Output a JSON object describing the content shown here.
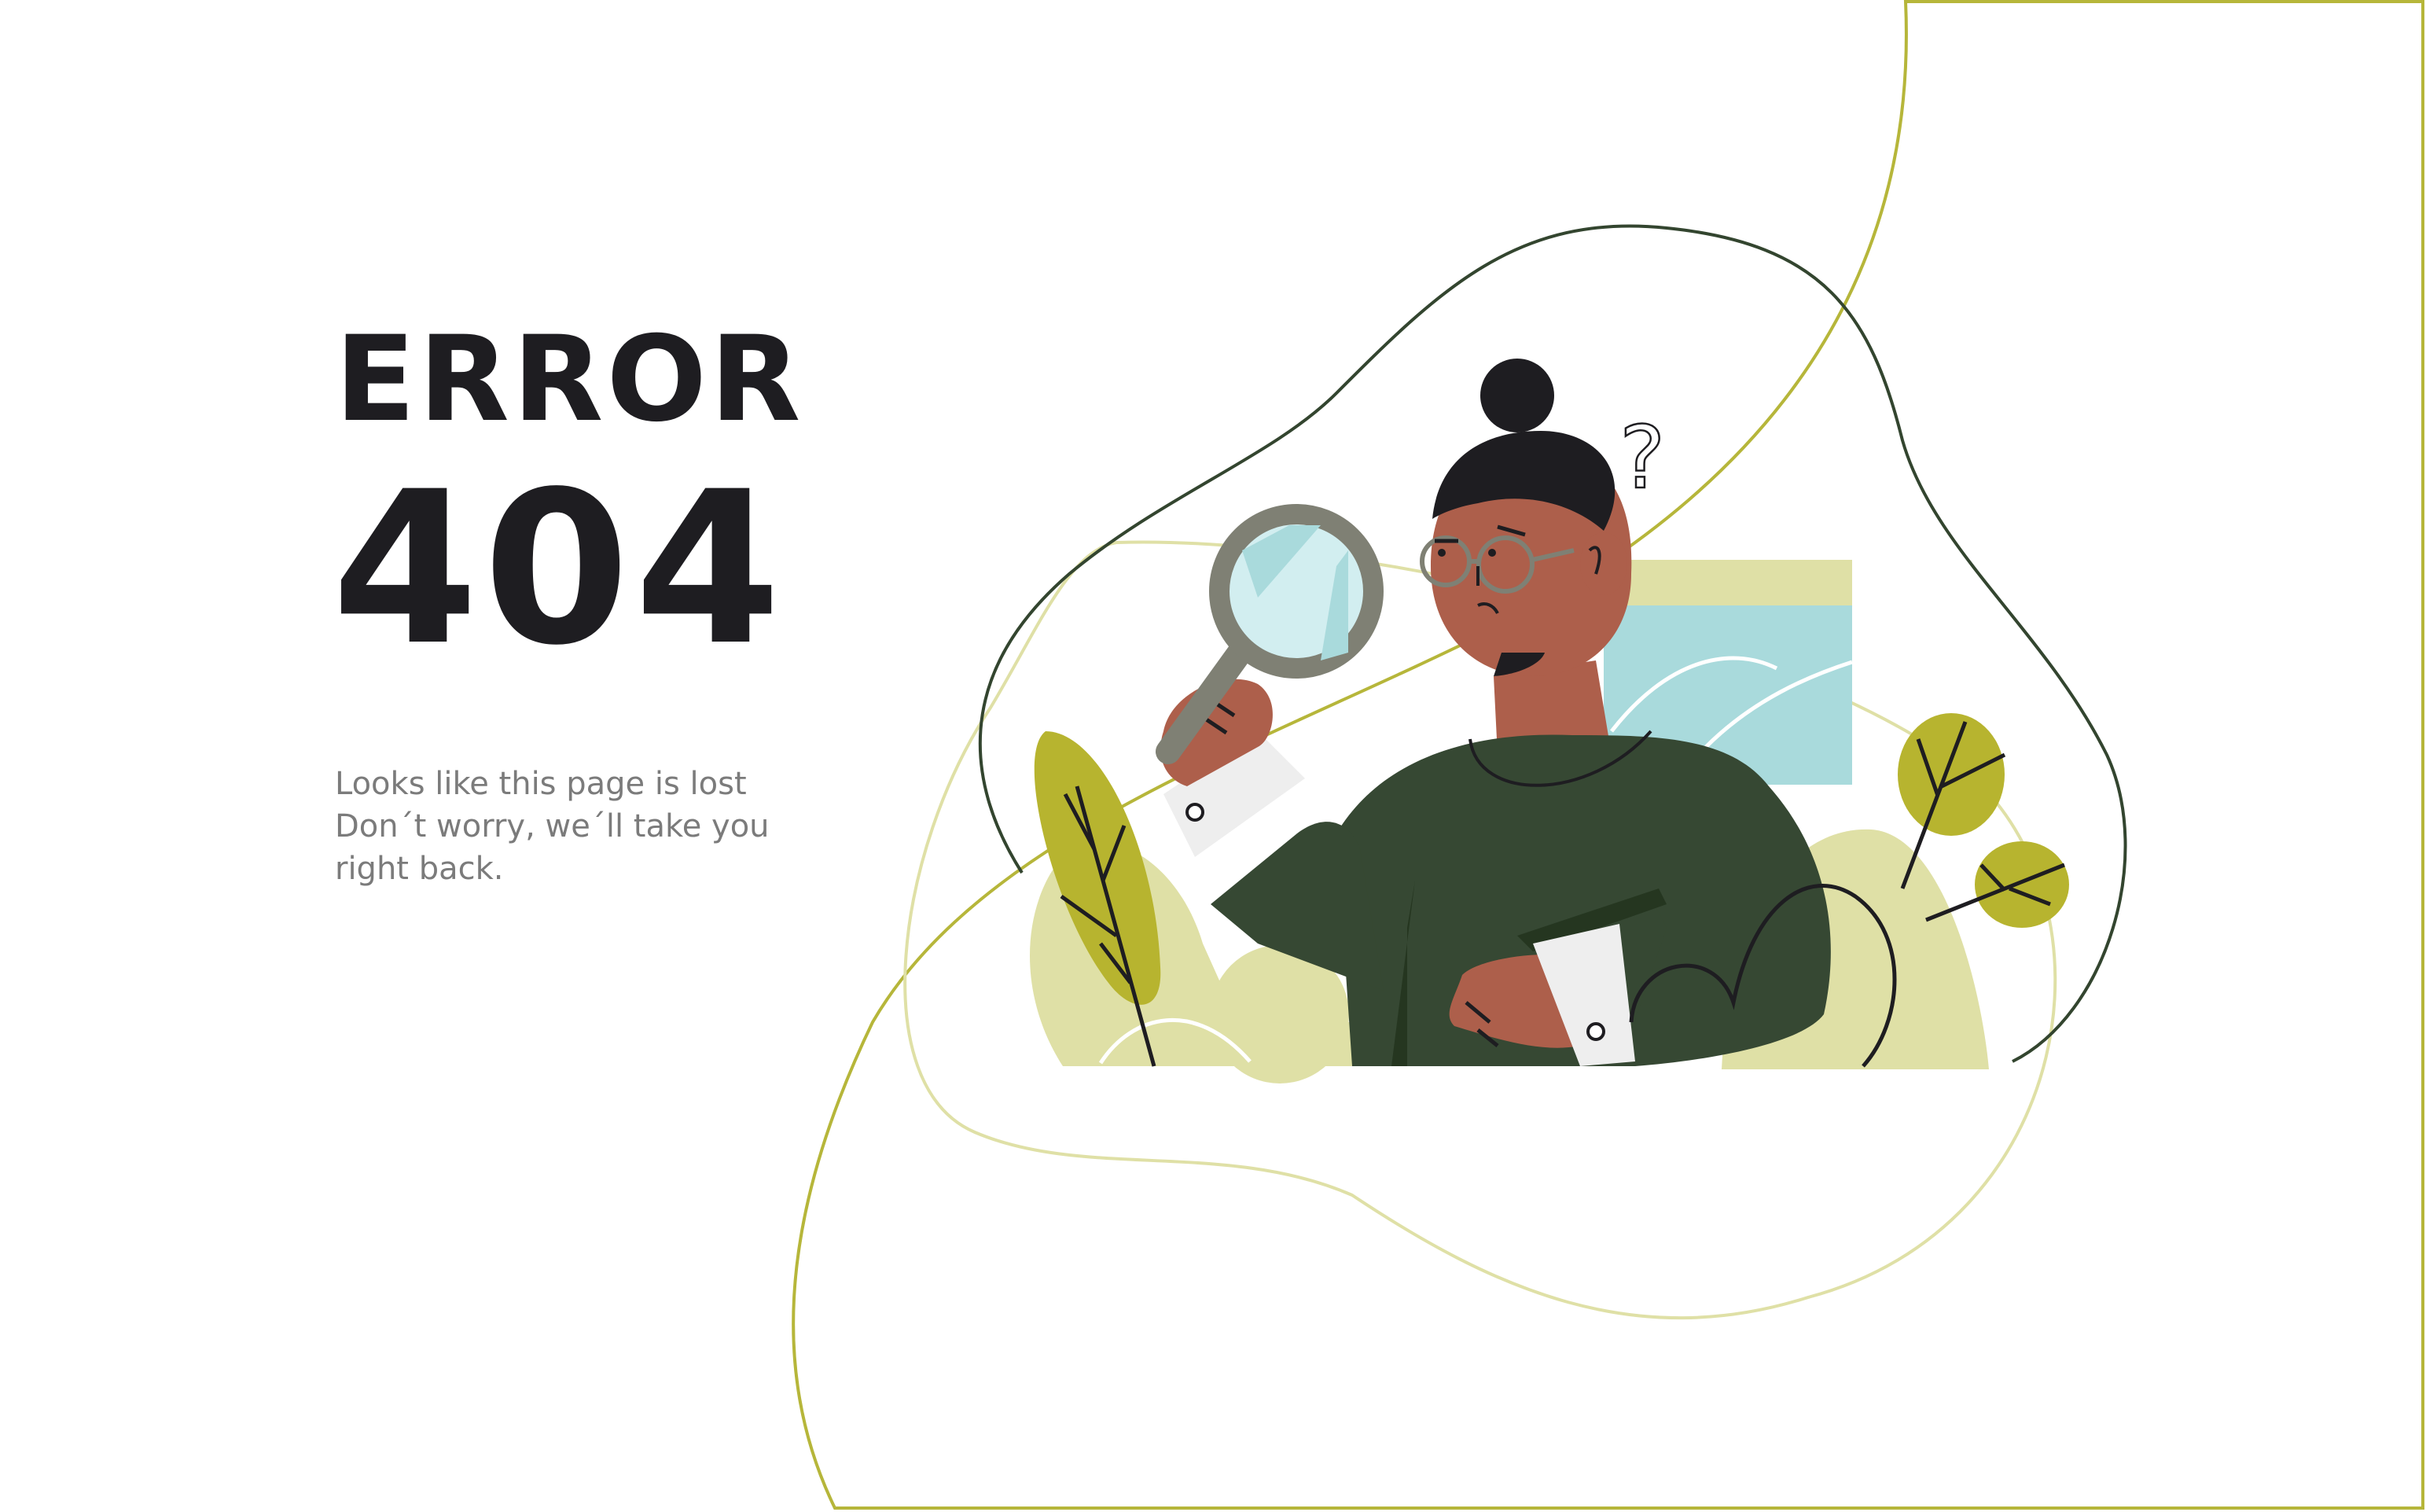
{
  "heading": {
    "title": "ERROR",
    "code": "404"
  },
  "message": {
    "line1": "Looks like this page is lost",
    "line2": "Don´t worry, we´ll take you",
    "line3": "right back."
  },
  "illustration": {
    "question_mark": "?",
    "icons": [
      "magnifying-glass-icon",
      "question-mark-icon"
    ]
  },
  "colors": {
    "text_dark": "#1e1d21",
    "text_muted": "#7b7b7b",
    "olive": "#b7b42f",
    "pale_olive": "#dfe0a6",
    "dark_green": "#364833",
    "skin": "#ad5f4b",
    "light_blue": "#a9dadc",
    "frame_line": "#b6b63a"
  }
}
